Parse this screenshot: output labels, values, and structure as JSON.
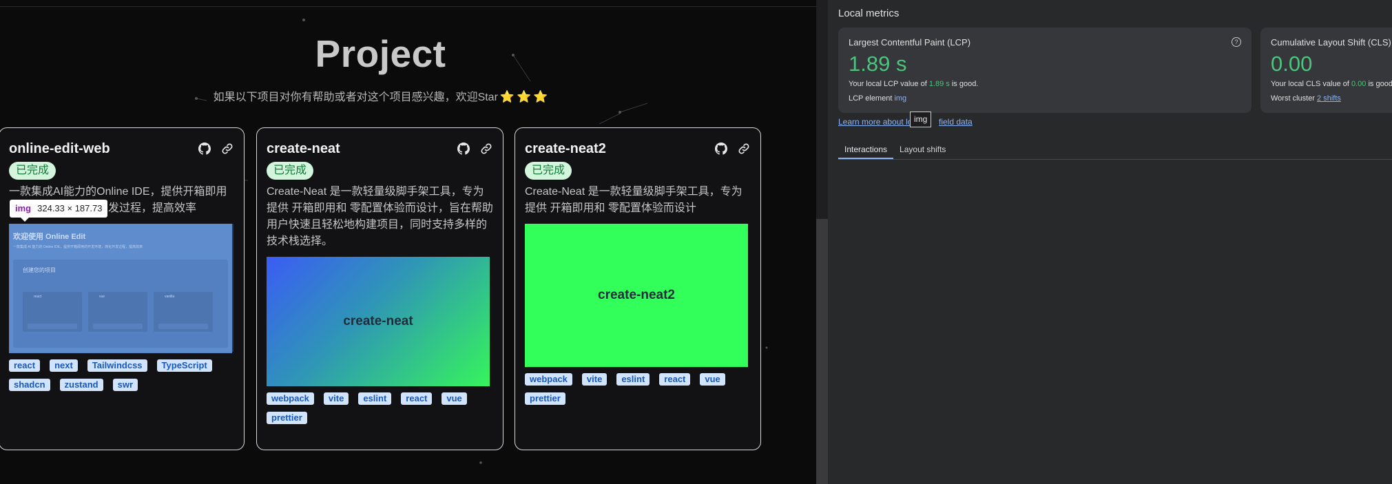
{
  "project": {
    "title": "Project",
    "subtitle": "如果以下项目对你有帮助或者对这个项目感兴趣，欢迎Star",
    "stars": [
      "⭐",
      "⭐",
      "⭐"
    ]
  },
  "cards": [
    {
      "title": "online-edit-web",
      "status": "已完成",
      "description": "一款集成AI能力的Online IDE，提供开箱即用的开发环境，简化开发过程，提高效率",
      "tags": [
        "react",
        "next",
        "Tailwindcss",
        "TypeScript",
        "shadcn",
        "zustand",
        "swr"
      ],
      "thumbnail": {
        "kind": "screenshot",
        "heading": "欢迎使用 Online Edit",
        "sub": "一款集成 AI 能力的 Online IDE，提供开箱即用的开发环境，简化开发过程，提高效率",
        "panel_title": "创建您的项目",
        "templates": [
          "react",
          "vue",
          "vanilla"
        ]
      }
    },
    {
      "title": "create-neat",
      "status": "已完成",
      "description": "Create-Neat 是一款轻量级脚手架工具，专为提供 开箱即用和 零配置体验而设计，旨在帮助用户快速且轻松地构建项目，同时支持多样的技术栈选择。",
      "tags": [
        "webpack",
        "vite",
        "eslint",
        "react",
        "vue",
        "prettier"
      ],
      "thumbnail": {
        "kind": "gradient",
        "label": "create-neat"
      }
    },
    {
      "title": "create-neat2",
      "status": "已完成",
      "description": "Create-Neat 是一款轻量级脚手架工具，专为提供 开箱即用和 零配置体验而设计",
      "tags": [
        "webpack",
        "vite",
        "eslint",
        "react",
        "vue",
        "prettier"
      ],
      "thumbnail": {
        "kind": "solid",
        "label": "create-neat2"
      }
    }
  ],
  "inspect_tooltip": {
    "tag": "img",
    "size": "324.33 × 187.73"
  },
  "devtools": {
    "heading": "Local metrics",
    "lcp": {
      "title": "Largest Contentful Paint (LCP)",
      "value": "1.89 s",
      "desc_prefix": "Your local LCP value of ",
      "desc_value": "1.89 s",
      "desc_suffix": " is good.",
      "element_label": "LCP element",
      "element_link": "img"
    },
    "cls": {
      "title": "Cumulative Layout Shift (CLS)",
      "value": "0.00",
      "desc_prefix": "Your local CLS value of ",
      "desc_value": "0.00",
      "desc_suffix": " is good.",
      "cluster_label": "Worst cluster",
      "cluster_link": "2 shifts"
    },
    "learn_link_start": "Learn more about lo",
    "learn_link_end": "field data",
    "img_hover_label": "img",
    "tabs": [
      "Interactions",
      "Layout shifts"
    ],
    "active_tab": "Interactions"
  },
  "colors": {
    "good_green": "#4cc47e",
    "link_blue": "#8ab4f8",
    "badge_bg": "#d3f5dc",
    "badge_text": "#117a37",
    "tag_bg": "#d2e4fb",
    "tag_text": "#1a58b7"
  }
}
